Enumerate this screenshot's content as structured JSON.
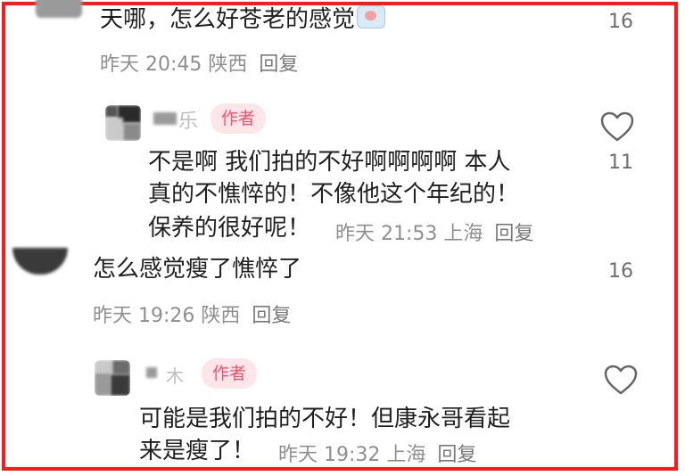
{
  "comments": [
    {
      "text": "天哪，怎么好苍老的感觉",
      "time": "昨天 20:45",
      "location": "陕西",
      "reply_label": "回复",
      "likes": "16",
      "emoji_icon": "sweat-face-icon"
    },
    {
      "author_badge": "作者",
      "name_fragment": "乐",
      "lines": [
        "不是啊 我们拍的不好啊啊啊啊 本人",
        "真的不憔悴的！不像他这个年纪的！",
        "保养的很好呢！"
      ],
      "time": "昨天 21:53",
      "location": "上海",
      "reply_label": "回复",
      "likes": "11"
    },
    {
      "text": "怎么感觉瘦了憔悴了",
      "time": "昨天 19:26",
      "location": "陕西",
      "reply_label": "回复",
      "likes": "16"
    },
    {
      "author_badge": "作者",
      "name_fragment": "木",
      "lines": [
        "可能是我们拍的不好！但康永哥看起",
        "来是瘦了！"
      ],
      "time": "昨天 19:32",
      "location": "上海",
      "reply_label": "回复"
    }
  ],
  "colors": {
    "frame": "#ff1a1a",
    "badge_bg": "#fde6ea",
    "badge_text": "#ff4d6a"
  }
}
